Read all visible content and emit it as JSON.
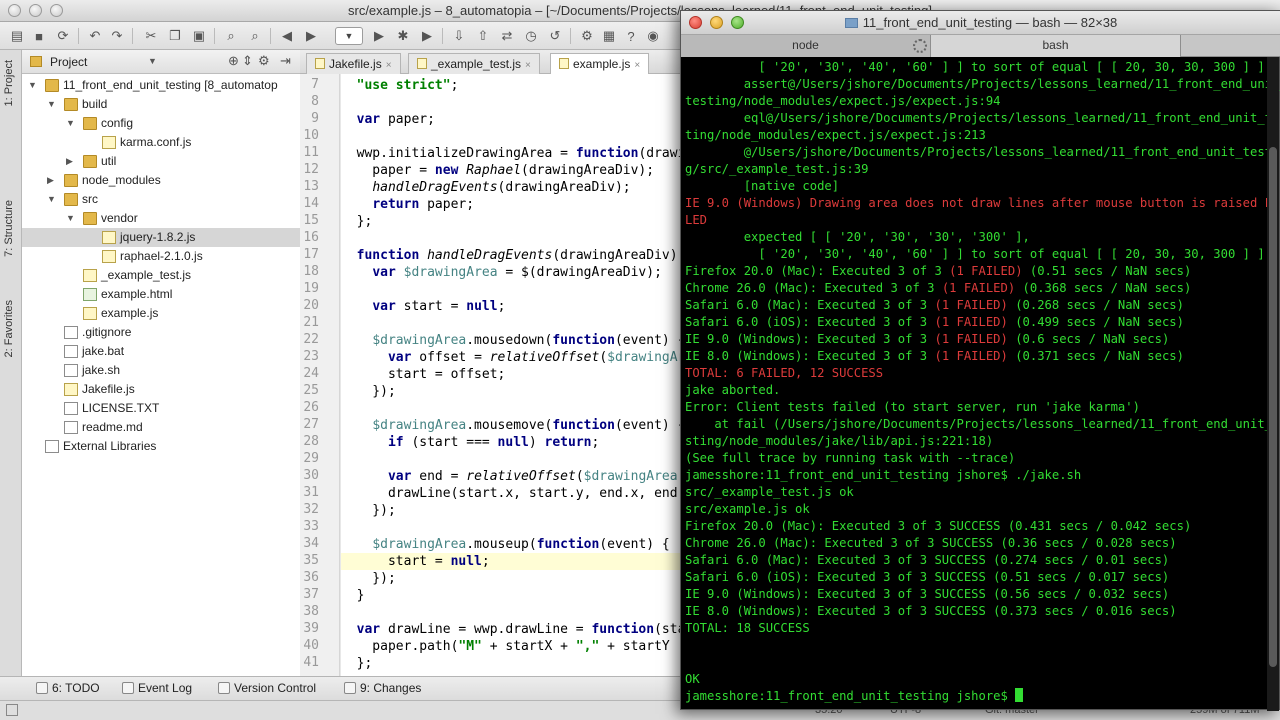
{
  "ide": {
    "window_title": "src/example.js – 8_automatopia – [~/Documents/Projects/lessons_learned/11_front_end_unit_testing]",
    "side_tabs": [
      "1: Project",
      "7: Structure",
      "2: Favorites"
    ],
    "project_panel": {
      "title": "Project",
      "tree": [
        {
          "label": "11_front_end_unit_testing [8_automatop",
          "type": "folder",
          "depth": 0,
          "arrow": "▼"
        },
        {
          "label": "build",
          "type": "folder",
          "depth": 1,
          "arrow": "▼"
        },
        {
          "label": "config",
          "type": "folder",
          "depth": 2,
          "arrow": "▼"
        },
        {
          "label": "karma.conf.js",
          "type": "js",
          "depth": 3,
          "arrow": ""
        },
        {
          "label": "util",
          "type": "folder",
          "depth": 2,
          "arrow": "▶"
        },
        {
          "label": "node_modules",
          "type": "folder",
          "depth": 1,
          "arrow": "▶"
        },
        {
          "label": "src",
          "type": "folder",
          "depth": 1,
          "arrow": "▼"
        },
        {
          "label": "vendor",
          "type": "folder",
          "depth": 2,
          "arrow": "▼"
        },
        {
          "label": "jquery-1.8.2.js",
          "type": "js",
          "depth": 3,
          "arrow": "",
          "selected": true
        },
        {
          "label": "raphael-2.1.0.js",
          "type": "js",
          "depth": 3,
          "arrow": ""
        },
        {
          "label": "_example_test.js",
          "type": "js",
          "depth": 2,
          "arrow": ""
        },
        {
          "label": "example.html",
          "type": "html",
          "depth": 2,
          "arrow": ""
        },
        {
          "label": "example.js",
          "type": "js",
          "depth": 2,
          "arrow": ""
        },
        {
          "label": ".gitignore",
          "type": "file",
          "depth": 1,
          "arrow": ""
        },
        {
          "label": "jake.bat",
          "type": "file",
          "depth": 1,
          "arrow": ""
        },
        {
          "label": "jake.sh",
          "type": "file",
          "depth": 1,
          "arrow": ""
        },
        {
          "label": "Jakefile.js",
          "type": "js",
          "depth": 1,
          "arrow": ""
        },
        {
          "label": "LICENSE.TXT",
          "type": "file",
          "depth": 1,
          "arrow": ""
        },
        {
          "label": "readme.md",
          "type": "file",
          "depth": 1,
          "arrow": ""
        },
        {
          "label": "External Libraries",
          "type": "lib",
          "depth": 0,
          "arrow": ""
        }
      ]
    },
    "editor_tabs": [
      {
        "label": "Jakefile.js",
        "active": false
      },
      {
        "label": "_example_test.js",
        "active": false
      },
      {
        "label": "example.js",
        "active": true
      }
    ],
    "code_lines": [
      {
        "n": "7",
        "text": "  \"use strict\";"
      },
      {
        "n": "8",
        "text": ""
      },
      {
        "n": "9",
        "text": "  var paper;"
      },
      {
        "n": "10",
        "text": ""
      },
      {
        "n": "11",
        "text": "  wwp.initializeDrawingArea = function(drawingAreaDiv) {"
      },
      {
        "n": "12",
        "text": "    paper = new Raphael(drawingAreaDiv);"
      },
      {
        "n": "13",
        "text": "    handleDragEvents(drawingAreaDiv);"
      },
      {
        "n": "14",
        "text": "    return paper;"
      },
      {
        "n": "15",
        "text": "  };"
      },
      {
        "n": "16",
        "text": ""
      },
      {
        "n": "17",
        "text": "  function handleDragEvents(drawingAreaDiv) {"
      },
      {
        "n": "18",
        "text": "    var $drawingArea = $(drawingAreaDiv);"
      },
      {
        "n": "19",
        "text": ""
      },
      {
        "n": "20",
        "text": "    var start = null;"
      },
      {
        "n": "21",
        "text": ""
      },
      {
        "n": "22",
        "text": "    $drawingArea.mousedown(function(event) {"
      },
      {
        "n": "23",
        "text": "      var offset = relativeOffset($drawingArea,"
      },
      {
        "n": "24",
        "text": "      start = offset;"
      },
      {
        "n": "25",
        "text": "    });"
      },
      {
        "n": "26",
        "text": ""
      },
      {
        "n": "27",
        "text": "    $drawingArea.mousemove(function(event) {"
      },
      {
        "n": "28",
        "text": "      if (start === null) return;"
      },
      {
        "n": "29",
        "text": ""
      },
      {
        "n": "30",
        "text": "      var end = relativeOffset($drawingArea,"
      },
      {
        "n": "31",
        "text": "      drawLine(start.x, start.y, end.x, end.y);"
      },
      {
        "n": "32",
        "text": "    });"
      },
      {
        "n": "33",
        "text": ""
      },
      {
        "n": "34",
        "text": "    $drawingArea.mouseup(function(event) {"
      },
      {
        "n": "35",
        "text": "      start = null;"
      },
      {
        "n": "36",
        "text": "    });"
      },
      {
        "n": "37",
        "text": "  }"
      },
      {
        "n": "38",
        "text": ""
      },
      {
        "n": "39",
        "text": "  var drawLine = wwp.drawLine = function(startX"
      },
      {
        "n": "40",
        "text": "    paper.path(\"M\" + startX + \",\" + startY"
      },
      {
        "n": "41",
        "text": "  };"
      }
    ],
    "bottom_tabs": [
      "6: TODO",
      "Event Log",
      "Version Control",
      "9: Changes"
    ],
    "status": {
      "position": "35:20",
      "encoding": "UTF-8",
      "vcs": "Git: master",
      "memory": "259M of 711M"
    }
  },
  "terminal": {
    "title": "11_front_end_unit_testing — bash — 82×38",
    "tabs": [
      "node",
      "bash"
    ],
    "lines": [
      {
        "t": "          [ '20', '30', '40', '60' ] ] to sort of equal [ [ 20, 30, 30, 300 ] ]",
        "c": "g"
      },
      {
        "t": "        assert@/Users/jshore/Documents/Projects/lessons_learned/11_front_end_unit_",
        "c": "g"
      },
      {
        "t": "testing/node_modules/expect.js/expect.js:94",
        "c": "g"
      },
      {
        "t": "        eql@/Users/jshore/Documents/Projects/lessons_learned/11_front_end_unit_tes",
        "c": "g"
      },
      {
        "t": "ting/node_modules/expect.js/expect.js:213",
        "c": "g"
      },
      {
        "t": "        @/Users/jshore/Documents/Projects/lessons_learned/11_front_end_unit_testin",
        "c": "g"
      },
      {
        "t": "g/src/_example_test.js:39",
        "c": "g"
      },
      {
        "t": "        [native code]",
        "c": "g"
      },
      {
        "t": "IE 9.0 (Windows) Drawing area does not draw lines after mouse button is raised FAI",
        "c": "r"
      },
      {
        "t": "LED",
        "c": "r"
      },
      {
        "t": "        expected [ [ '20', '30', '30', '300' ],",
        "c": "g"
      },
      {
        "t": "          [ '20', '30', '40', '60' ] ] to sort of equal [ [ 20, 30, 30, 300 ] ]",
        "c": "g"
      },
      {
        "t": "Firefox 20.0 (Mac): Executed 3 of 3 |(1 FAILED)| (0.51 secs / NaN secs)",
        "c": "mix"
      },
      {
        "t": "Chrome 26.0 (Mac): Executed 3 of 3 |(1 FAILED)| (0.368 secs / NaN secs)",
        "c": "mix"
      },
      {
        "t": "Safari 6.0 (Mac): Executed 3 of 3 |(1 FAILED)| (0.268 secs / NaN secs)",
        "c": "mix"
      },
      {
        "t": "Safari 6.0 (iOS): Executed 3 of 3 |(1 FAILED)| (0.499 secs / NaN secs)",
        "c": "mix"
      },
      {
        "t": "IE 9.0 (Windows): Executed 3 of 3 |(1 FAILED)| (0.6 secs / NaN secs)",
        "c": "mix"
      },
      {
        "t": "IE 8.0 (Windows): Executed 3 of 3 |(1 FAILED)| (0.371 secs / NaN secs)",
        "c": "mix"
      },
      {
        "t": "TOTAL: 6 FAILED, 12 SUCCESS",
        "c": "r"
      },
      {
        "t": "jake aborted.",
        "c": "g"
      },
      {
        "t": "Error: Client tests failed (to start server, run 'jake karma')",
        "c": "g"
      },
      {
        "t": "    at fail (/Users/jshore/Documents/Projects/lessons_learned/11_front_end_unit_te",
        "c": "g"
      },
      {
        "t": "sting/node_modules/jake/lib/api.js:221:18)",
        "c": "g"
      },
      {
        "t": "(See full trace by running task with --trace)",
        "c": "g"
      },
      {
        "t": "jamesshore:11_front_end_unit_testing jshore$ ./jake.sh",
        "c": "g"
      },
      {
        "t": "src/_example_test.js ok",
        "c": "g"
      },
      {
        "t": "src/example.js ok",
        "c": "g"
      },
      {
        "t": "Firefox 20.0 (Mac): Executed 3 of 3 SUCCESS (0.431 secs / 0.042 secs)",
        "c": "g"
      },
      {
        "t": "Chrome 26.0 (Mac): Executed 3 of 3 SUCCESS (0.36 secs / 0.028 secs)",
        "c": "g"
      },
      {
        "t": "Safari 6.0 (Mac): Executed 3 of 3 SUCCESS (0.274 secs / 0.01 secs)",
        "c": "g"
      },
      {
        "t": "Safari 6.0 (iOS): Executed 3 of 3 SUCCESS (0.51 secs / 0.017 secs)",
        "c": "g"
      },
      {
        "t": "IE 9.0 (Windows): Executed 3 of 3 SUCCESS (0.56 secs / 0.032 secs)",
        "c": "g"
      },
      {
        "t": "IE 8.0 (Windows): Executed 3 of 3 SUCCESS (0.373 secs / 0.016 secs)",
        "c": "g"
      },
      {
        "t": "TOTAL: 18 SUCCESS",
        "c": "g"
      },
      {
        "t": "",
        "c": "g"
      },
      {
        "t": "",
        "c": "g"
      },
      {
        "t": "OK",
        "c": "g"
      },
      {
        "t": "jamesshore:11_front_end_unit_testing jshore$ ",
        "c": "prompt"
      }
    ]
  },
  "colors": {
    "terminal_green": "#33dd33",
    "terminal_red": "#dd3b3b",
    "editor_keyword": "#000080",
    "editor_string": "#008000"
  }
}
